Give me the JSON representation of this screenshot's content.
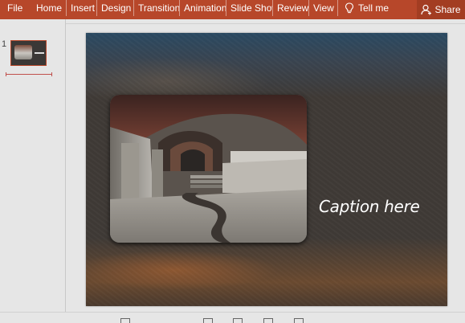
{
  "ribbon": {
    "file": "File",
    "tabs": [
      "Home",
      "Insert",
      "Design",
      "Transitions",
      "Animations",
      "Slide Show",
      "Review",
      "View"
    ],
    "tell_me": "Tell me",
    "share": "Share",
    "accent": "#b7472a"
  },
  "thumbnails": {
    "slide_number": "1"
  },
  "slide": {
    "caption": "Caption here"
  },
  "icons": [
    "lightbulb-icon",
    "share-person-icon"
  ]
}
